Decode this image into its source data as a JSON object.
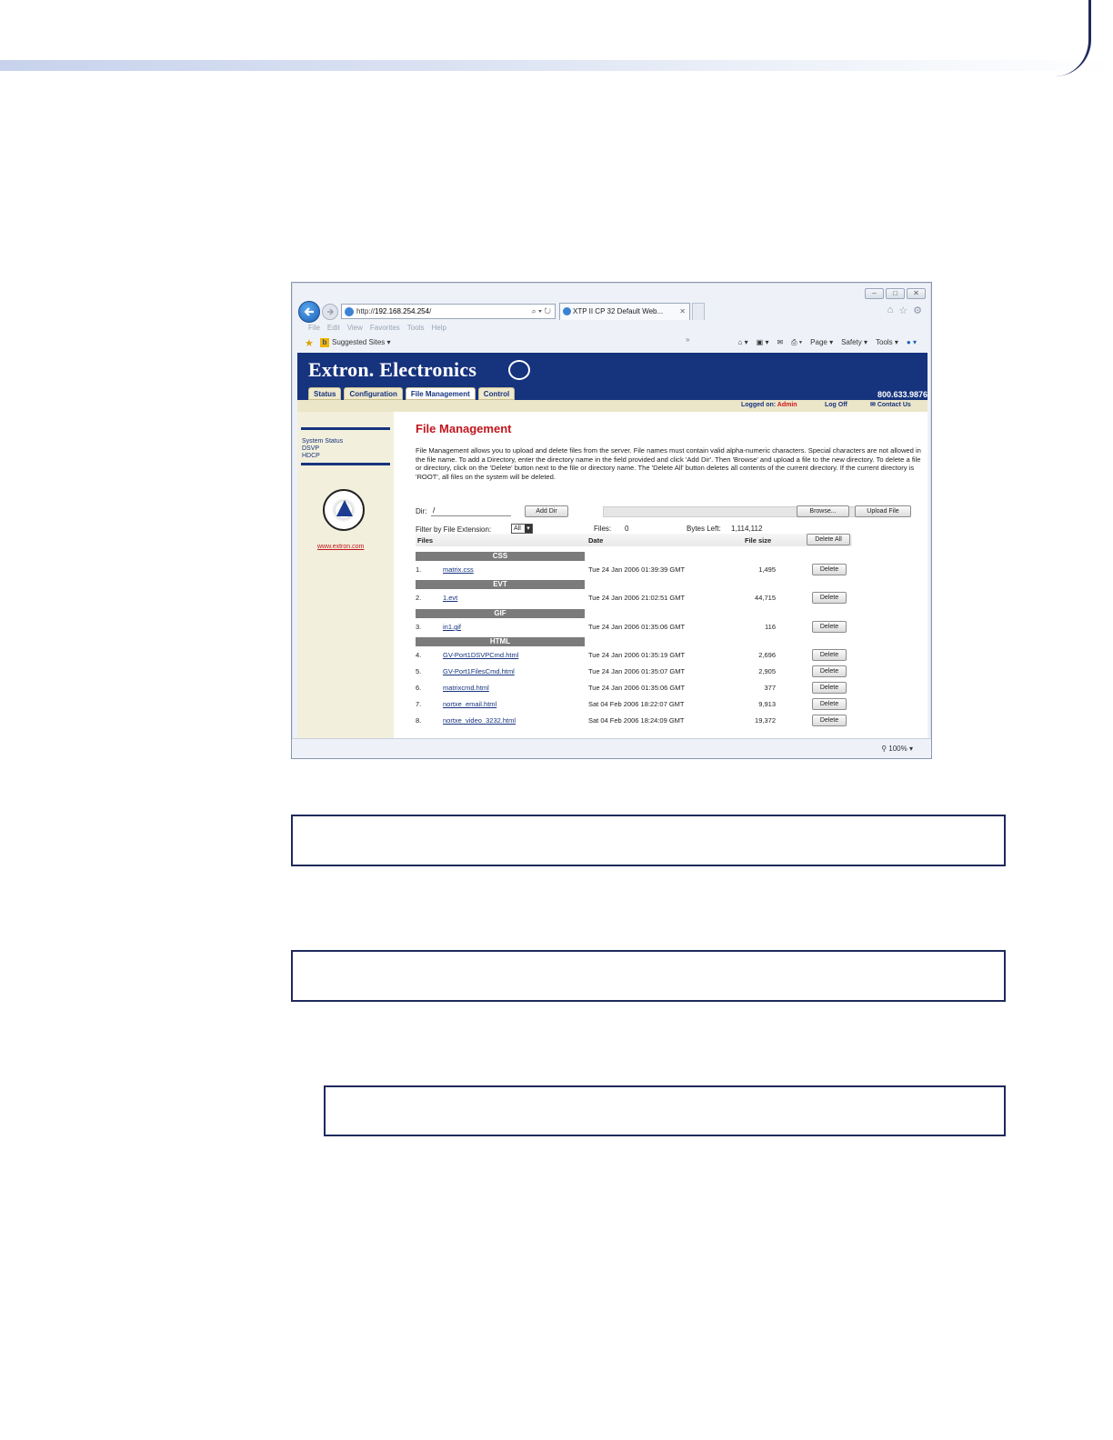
{
  "browser": {
    "address": {
      "prefix": "http://",
      "host": "192.168.254.254",
      "suffix": "/"
    },
    "tab_title": "XTP II CP 32 Default Web...",
    "menu": [
      "File",
      "Edit",
      "View",
      "Favorites",
      "Tools",
      "Help"
    ],
    "favorites": {
      "suggested": "Suggested Sites ▾"
    },
    "toolbar": [
      "Page ▾",
      "Safety ▾",
      "Tools ▾"
    ],
    "zoom": "100%"
  },
  "site": {
    "brand": "Extron. Electronics",
    "nav_tabs": [
      "Status",
      "Configuration",
      "File Management",
      "Control"
    ],
    "phone": "800.633.9876",
    "logged_on_label": "Logged on:",
    "logged_on_user": "Admin",
    "log_off": "Log Off",
    "contact": "Contact Us",
    "sidebar_links": [
      "System Status",
      "DSVP",
      "HDCP"
    ],
    "sidebar_url": "www.extron.com",
    "page_title": "File Management",
    "description": "File Management allows you to upload and delete files from the server. File names must contain valid alpha-numeric characters. Special characters are not allowed in the file name. To add a Directory, enter the directory name in the field provided and click 'Add Dir'. Then 'Browse' and upload a file to the new directory. To delete a file or directory, click on the 'Delete' button next to the file or directory name. The 'Delete All' button deletes all contents of the current directory. If the current directory is 'ROOT', all files on the system will be deleted.",
    "dir_label": "Dir:",
    "dir_value": "/",
    "add_dir": "Add Dir",
    "browse": "Browse...",
    "upload": "Upload File",
    "filter_label": "Filter by File Extension:",
    "filter_value": "All",
    "files_count_label": "Files:",
    "files_count": "0",
    "bytes_left_label": "Bytes Left:",
    "bytes_left": "1,114,112",
    "col_files": "Files",
    "col_date": "Date",
    "col_size": "File size",
    "delete_all": "Delete All",
    "delete": "Delete",
    "groups": [
      "CSS",
      "EVT",
      "GIF",
      "HTML"
    ],
    "files": [
      {
        "num": "1.",
        "name": "matrix.css",
        "date": "Tue 24 Jan 2006 01:39:39 GMT",
        "size": "1,495"
      },
      {
        "num": "2.",
        "name": "1.evt",
        "date": "Tue 24 Jan 2006 21:02:51 GMT",
        "size": "44,715"
      },
      {
        "num": "3.",
        "name": "in1.gif",
        "date": "Tue 24 Jan 2006 01:35:06 GMT",
        "size": "116"
      },
      {
        "num": "4.",
        "name": "GV-Port1DSVPCmd.html",
        "date": "Tue 24 Jan 2006 01:35:19 GMT",
        "size": "2,696"
      },
      {
        "num": "5.",
        "name": "GV-Port1FilesCmd.html",
        "date": "Tue 24 Jan 2006 01:35:07 GMT",
        "size": "2,905"
      },
      {
        "num": "6.",
        "name": "matrixcmd.html",
        "date": "Tue 24 Jan 2006 01:35:06 GMT",
        "size": "377"
      },
      {
        "num": "7.",
        "name": "nortxe_email.html",
        "date": "Sat 04 Feb 2006 18:22:07 GMT",
        "size": "9,913"
      },
      {
        "num": "8.",
        "name": "nortxe_video_3232.html",
        "date": "Sat 04 Feb 2006 18:24:09 GMT",
        "size": "19,372"
      }
    ]
  }
}
